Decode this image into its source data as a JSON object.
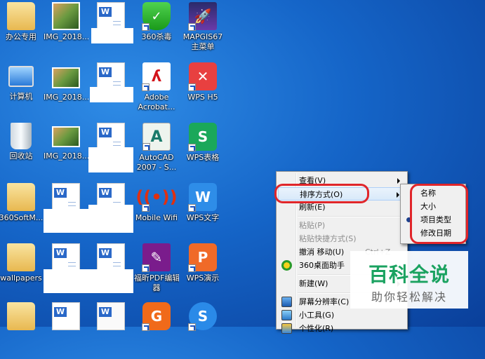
{
  "desktop": {
    "icons": {
      "r1": [
        "办公专用",
        "IMG_2018...",
        "",
        "360杀毒",
        "MAPGIS67",
        "主菜单"
      ],
      "r2": [
        "计算机",
        "IMG_2018...",
        "",
        "Adobe",
        "Acrobat...",
        "WPS H5"
      ],
      "r3": [
        "回收站",
        "IMG_2018...",
        "",
        "AutoCAD",
        "2007 - S...",
        "WPS表格"
      ],
      "r4": [
        "360SoftM...",
        "",
        "",
        "Mobile Wifi",
        "WPS文字"
      ],
      "r5": [
        "wallpapers",
        "",
        "",
        "福昕PDF编辑",
        "器",
        "WPS演示"
      ]
    }
  },
  "menu": {
    "items": [
      {
        "label": "查看(V)"
      },
      {
        "label": "排序方式(O)"
      },
      {
        "label": "刷新(E)"
      },
      {
        "label": "粘贴(P)"
      },
      {
        "label": "粘贴快捷方式(S)"
      },
      {
        "label": "撤消 移动(U)",
        "shortcut": "Ctrl+Z"
      },
      {
        "label": "360桌面助手"
      },
      {
        "label": "新建(W)"
      },
      {
        "label": "屏幕分辨率(C)"
      },
      {
        "label": "小工具(G)"
      },
      {
        "label": "个性化(R)"
      }
    ]
  },
  "submenu": {
    "items": [
      "名称",
      "大小",
      "项目类型",
      "修改日期"
    ],
    "selected": "项目类型"
  },
  "watermark": {
    "title": "百科全说",
    "subtitle": "助你轻松解决"
  },
  "colors": {
    "accent_red": "#e0252a",
    "watermark_green": "#1aa260",
    "desktop_blue": "#1565c8"
  }
}
